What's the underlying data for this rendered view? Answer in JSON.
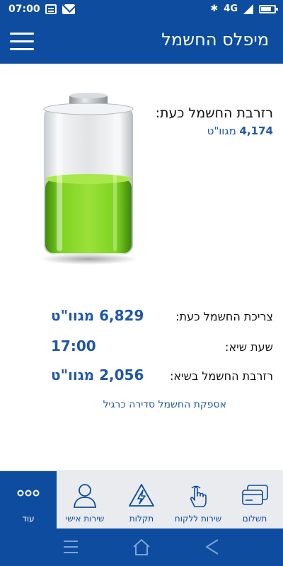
{
  "status_bar": {
    "time": "07:00",
    "network": "4G",
    "icons": [
      "message-icon",
      "mail-icon",
      "bluetooth-icon",
      "signal-icon",
      "battery-icon"
    ]
  },
  "header": {
    "title": "מיפלס החשמל",
    "menu_icon": "hamburger-menu-icon"
  },
  "reserve": {
    "title": "רזרבת החשמל כעת:",
    "value": "4,174",
    "unit": "מגוו\"ט",
    "fill_fraction": 0.52
  },
  "info_rows": [
    {
      "label": "צריכת החשמל כעת:",
      "value": "6,829 מגוו\"ט"
    },
    {
      "label": "שעת שיא:",
      "value": "17:00"
    },
    {
      "label": "רזרבת החשמל בשיא:",
      "value": "2,056 מגוו\"ט"
    }
  ],
  "status_link": "אספקת החשמל סדירה כרגיל",
  "bottom_nav": {
    "items": [
      {
        "label": "תשלום",
        "icon": "payment-cards-icon"
      },
      {
        "label": "שירות ללקוח",
        "icon": "touch-hand-icon"
      },
      {
        "label": "תקלות",
        "icon": "lightning-warning-icon"
      },
      {
        "label": "שירות אישי",
        "icon": "person-icon"
      },
      {
        "label": "עוד",
        "icon": "more-dots-icon"
      }
    ],
    "active_label": "עוד"
  },
  "system_nav": [
    "recent-apps-icon",
    "home-icon",
    "back-icon"
  ],
  "colors": {
    "brand_blue": "#0d4c9e",
    "value_blue": "#1f57a8",
    "battery_green": "#7ed321"
  }
}
